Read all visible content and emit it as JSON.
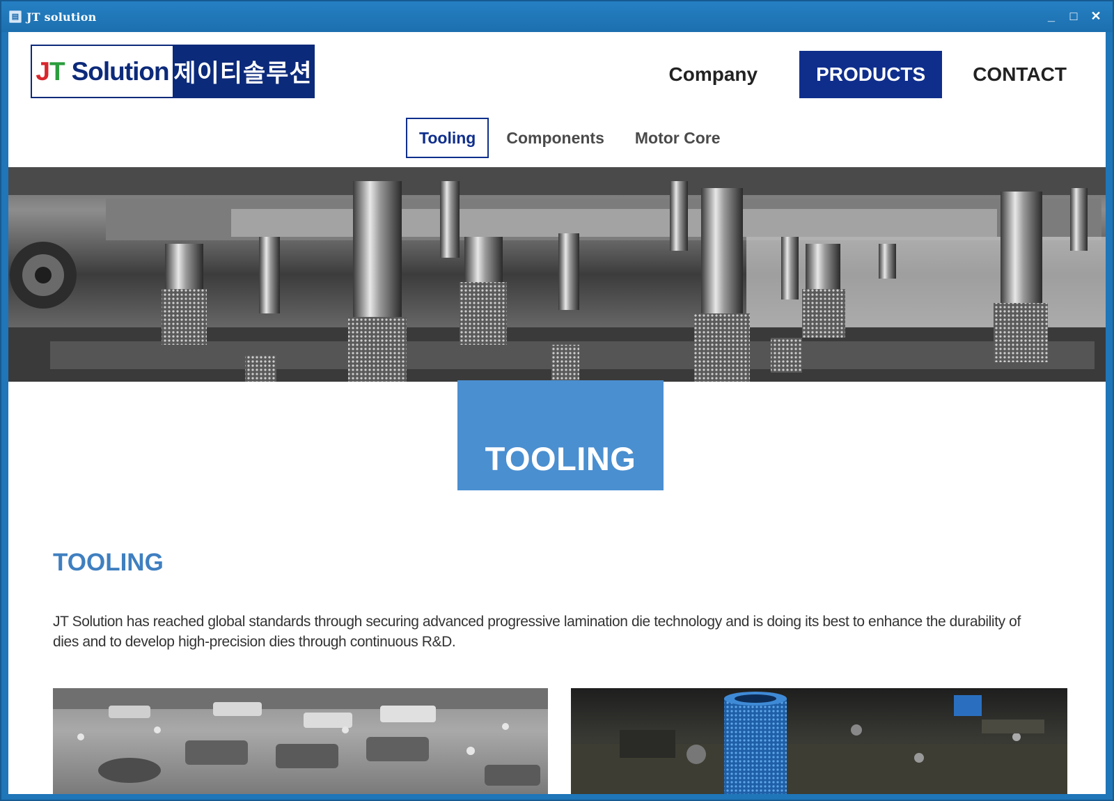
{
  "window": {
    "title": "JT solution",
    "controls": {
      "minimize": "_",
      "maximize": "□",
      "close": "✕"
    }
  },
  "logo": {
    "latin_j": "J",
    "latin_t": "T",
    "latin_rest": "Solution",
    "korean": "제이티솔루션"
  },
  "nav": {
    "company": "Company",
    "products": "PRODUCTS",
    "contact": "CONTACT"
  },
  "subnav": {
    "tooling": "Tooling",
    "components": "Components",
    "motor_core": "Motor Core"
  },
  "hero": {
    "title": "TOOLING"
  },
  "content": {
    "heading": "TOOLING",
    "description": "JT Solution has reached global standards through securing advanced progressive lamination die technology and is doing its best to enhance the durability of dies and to develop high-precision dies through continuous R&D."
  },
  "colors": {
    "brand_navy": "#0f2e8c",
    "accent_blue": "#4a8fd0",
    "window_blue": "#1f76b8",
    "logo_red": "#d8262d",
    "logo_green": "#2a9d3c"
  }
}
